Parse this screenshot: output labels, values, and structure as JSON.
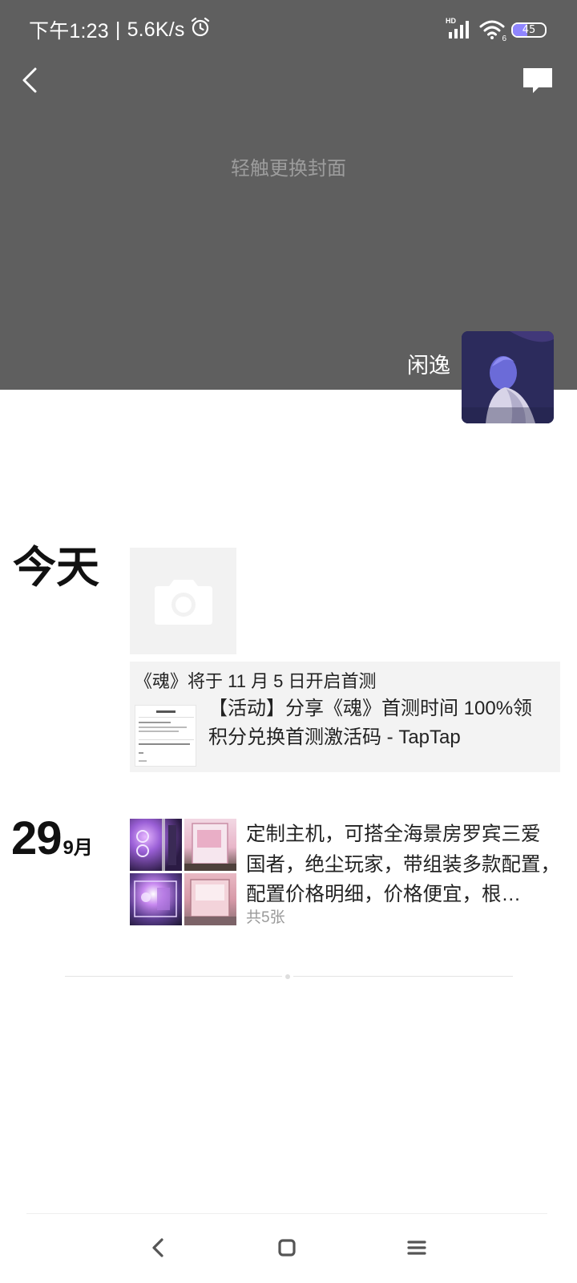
{
  "status_bar": {
    "time": "下午1:23",
    "separator": "|",
    "net_speed": "5.6K/s",
    "hd": "HD",
    "wifi_sub": "6",
    "battery": "45",
    "battery_level": 0.45,
    "icons": [
      "alarm-icon",
      "signal-icon",
      "wifi-icon",
      "battery-icon"
    ]
  },
  "header": {
    "back_icon": "chevron-left-icon",
    "comment_icon": "comment-icon"
  },
  "cover": {
    "hint": "轻触更换封面"
  },
  "profile": {
    "username": "闲逸"
  },
  "moments": [
    {
      "date_label": "今天",
      "share_text": "《魂》将于 11 月 5 日开启首测",
      "link_title_lines": [
        "【活动】分享《魂》首测时间 100%领",
        "积分兑换首测激活码 - TapTap"
      ]
    },
    {
      "day": "29",
      "month": "9月",
      "text_lines": [
        "定制主机，可搭全海景房罗宾三爱",
        "国者，绝尘玩家，带组装多款配置，",
        "配置价格明细，价格便宜，根…"
      ],
      "photo_count": "共5张"
    }
  ],
  "nav": {
    "icons": [
      "nav-back-icon",
      "nav-home-icon",
      "nav-menu-icon"
    ]
  },
  "colors": {
    "cover_bg": "#5f5f5f",
    "hint_text": "#9c9c9c",
    "card_bg": "#f3f3f3",
    "battery_fill": "#8f85ff"
  }
}
